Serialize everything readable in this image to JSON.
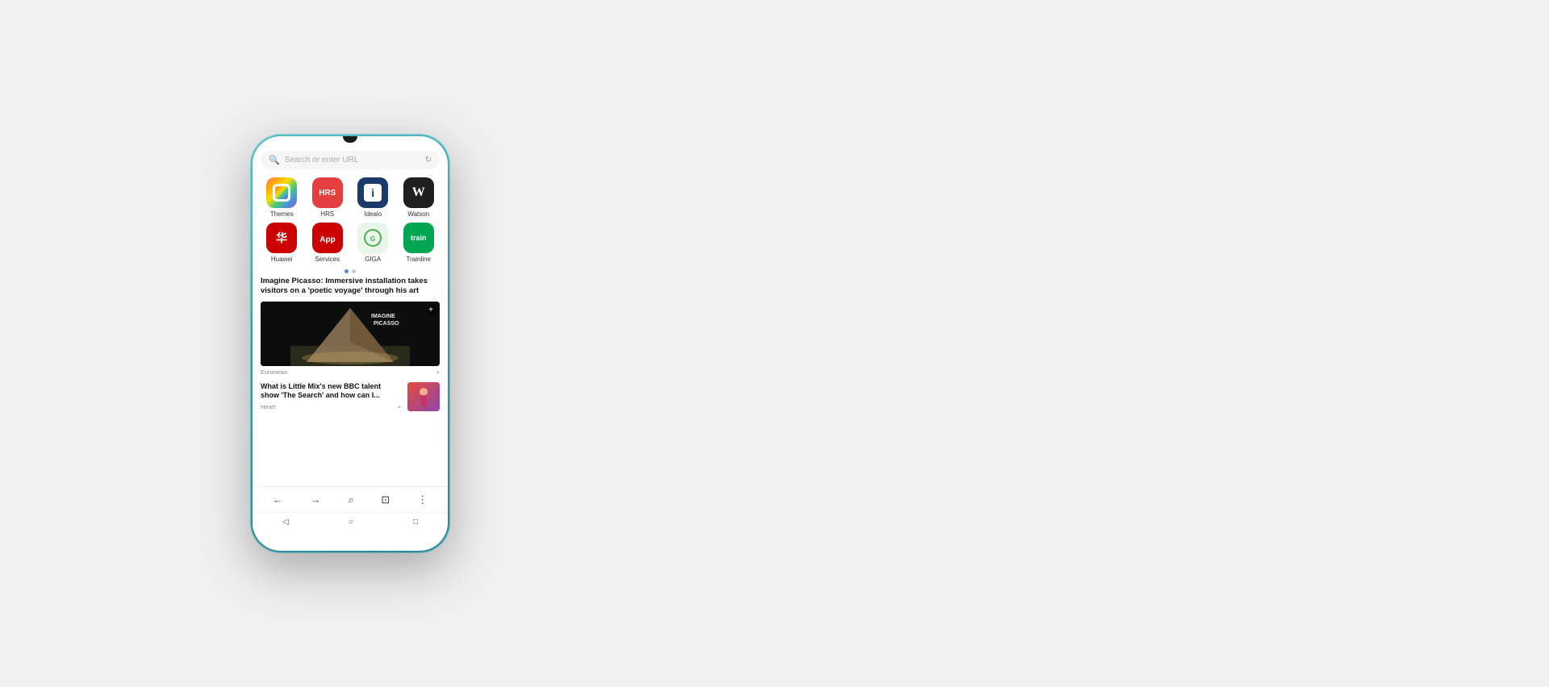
{
  "phone": {
    "search": {
      "placeholder": "Search or enter URL"
    },
    "apps": [
      {
        "id": "themes",
        "label": "Themes",
        "iconType": "themes"
      },
      {
        "id": "hrs",
        "label": "HRS",
        "iconType": "hrs"
      },
      {
        "id": "idealo",
        "label": "Idealo",
        "iconType": "idealo"
      },
      {
        "id": "watson",
        "label": "Watson",
        "iconType": "watson"
      },
      {
        "id": "huawei",
        "label": "Huawei",
        "iconType": "huawei"
      },
      {
        "id": "services",
        "label": "Services",
        "iconType": "services"
      },
      {
        "id": "giga",
        "label": "GIGA",
        "iconType": "giga"
      },
      {
        "id": "trainline",
        "label": "Trainline",
        "iconType": "trainline"
      }
    ],
    "news": [
      {
        "id": "picasso",
        "title": "Imagine Picasso: Immersive installation takes visitors on a 'poetic voyage' through his art",
        "source": "Euronews",
        "hasImage": true
      },
      {
        "id": "littlemix",
        "title": "What is Little Mix's new BBC talent show 'The Search' and how can I...",
        "source": "Heart",
        "hasThumb": true
      }
    ],
    "bottomNav": {
      "back": "←",
      "forward": "→",
      "search": "🔍",
      "tabs": "⊡",
      "more": "⋮"
    },
    "androidNav": {
      "back": "◁",
      "home": "○",
      "recents": "□"
    }
  }
}
